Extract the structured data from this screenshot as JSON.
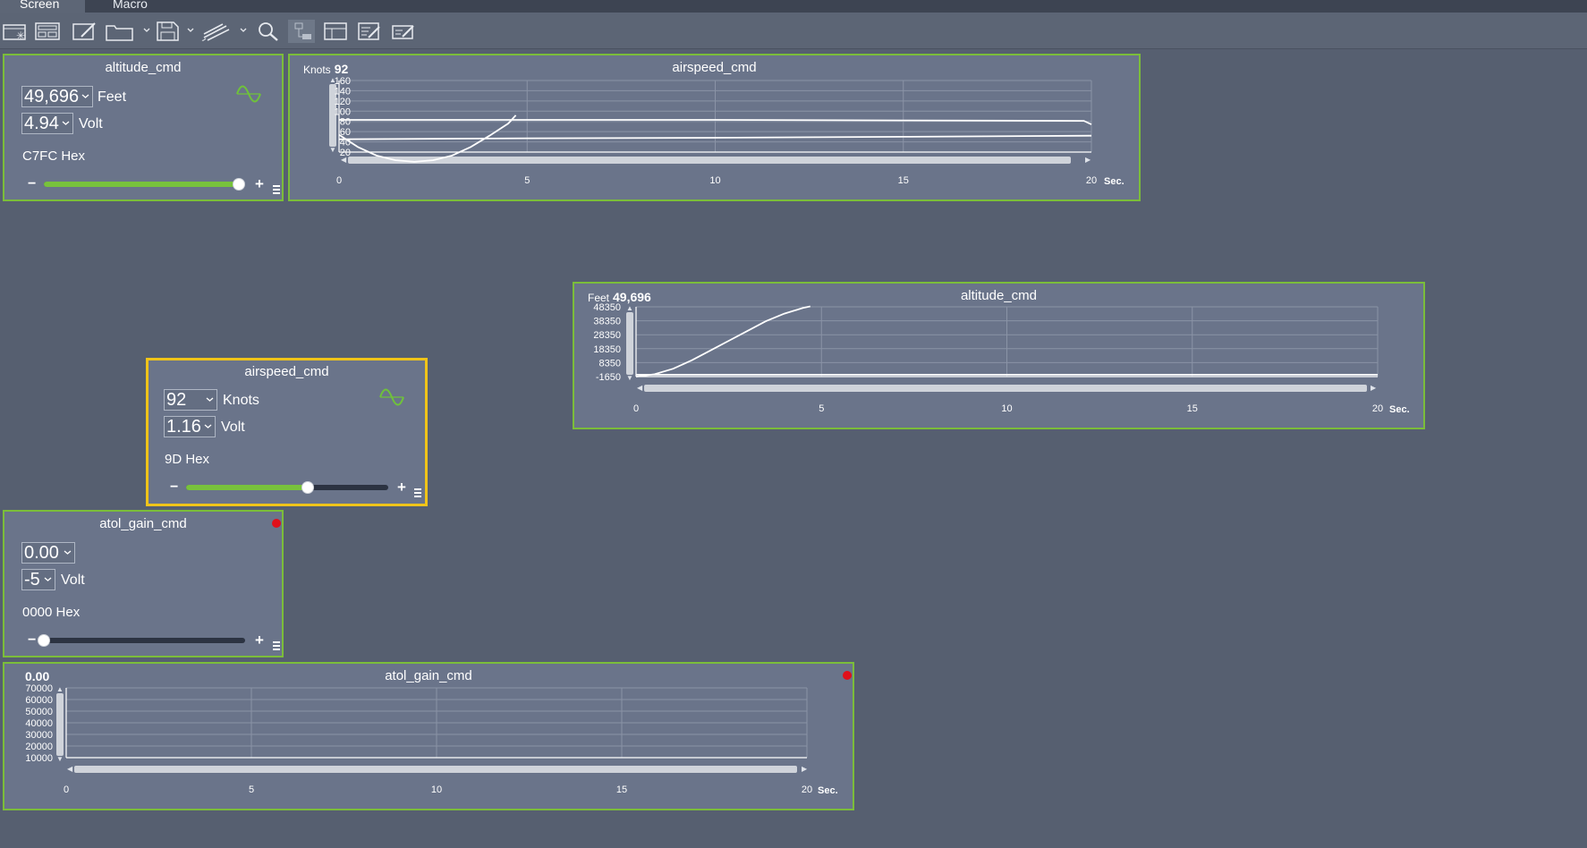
{
  "tabs": [
    {
      "label": "Screen",
      "active": true
    },
    {
      "label": "Macro",
      "active": false
    }
  ],
  "toolbar": {
    "buttons": [
      "new-screen-icon",
      "layout-icon",
      "edit-icon",
      "open-folder-icon",
      "save-icon",
      "plugin-icon",
      "search-icon",
      "route-icon",
      "table-icon",
      "edit-list-icon",
      "edit-form-icon"
    ]
  },
  "colors": {
    "background": "#565f70",
    "panel": "#6a748a",
    "panel_border": "#7bbd3a",
    "selected_border": "#f0c419",
    "slider_fill": "#78c23c",
    "alert": "#e0101a"
  },
  "control_altitude": {
    "title": "altitude_cmd",
    "value": "49,696",
    "unit": "Feet",
    "volt": "4.94",
    "volt_unit": "Volt",
    "hex": "C7FC Hex",
    "slider_fraction": 0.97
  },
  "control_airspeed": {
    "title": "airspeed_cmd",
    "value": "92",
    "unit": "Knots",
    "volt": "1.16",
    "volt_unit": "Volt",
    "hex": "9D Hex",
    "slider_fraction": 0.6
  },
  "control_atol": {
    "title": "atol_gain_cmd",
    "value": "0.00",
    "volt": "-5",
    "volt_unit": "Volt",
    "hex": "0000 Hex",
    "slider_fraction": 0.0
  },
  "chart_data": [
    {
      "id": "airspeed",
      "type": "line",
      "title": "airspeed_cmd",
      "readout_label": "Knots",
      "readout_value": "92",
      "xlabel": "Sec.",
      "xlim": [
        0,
        20
      ],
      "ylim": [
        20,
        160
      ],
      "x_ticks": [
        "0",
        "5",
        "10",
        "15",
        "20"
      ],
      "y_ticks": [
        "160",
        "140",
        "120",
        "100",
        "80",
        "60",
        "40",
        "20"
      ],
      "grid": true,
      "series": [
        {
          "x": [
            0,
            0.5,
            1,
            1.5,
            2,
            2.5,
            3,
            3.5,
            4,
            4.5,
            4.7
          ],
          "y": [
            54,
            30,
            13,
            4,
            1,
            4,
            13,
            30,
            52,
            76,
            92
          ]
        },
        {
          "x": [
            0,
            5,
            10,
            15,
            19.8,
            20
          ],
          "y": [
            83,
            83,
            83,
            82,
            81,
            74
          ]
        },
        {
          "x": [
            0,
            5,
            10,
            15,
            20
          ],
          "y": [
            45,
            47,
            48,
            50,
            52
          ]
        }
      ]
    },
    {
      "id": "altitude",
      "type": "line",
      "title": "altitude_cmd",
      "readout_label": "Feet",
      "readout_value": "49,696",
      "xlabel": "Sec.",
      "xlim": [
        0,
        20
      ],
      "ylim": [
        -1650,
        48350
      ],
      "x_ticks": [
        "0",
        "5",
        "10",
        "15",
        "20"
      ],
      "y_ticks": [
        "48350",
        "38350",
        "28350",
        "18350",
        "8350",
        "-1650"
      ],
      "grid": true,
      "series": [
        {
          "x": [
            0,
            0.5,
            1,
            1.5,
            2,
            2.5,
            3,
            3.5,
            4,
            4.5,
            4.7
          ],
          "y": [
            -1650,
            0,
            4000,
            10000,
            17000,
            24000,
            31000,
            38000,
            43500,
            47500,
            48700
          ]
        },
        {
          "x": [
            0,
            20
          ],
          "y": [
            -300,
            -300
          ]
        }
      ]
    },
    {
      "id": "atol",
      "type": "line",
      "title": "atol_gain_cmd",
      "readout_value": "0.00",
      "xlabel": "Sec.",
      "xlim": [
        0,
        20
      ],
      "ylim": [
        0,
        70000
      ],
      "x_ticks": [
        "0",
        "5",
        "10",
        "15",
        "20"
      ],
      "y_ticks": [
        "70000",
        "60000",
        "50000",
        "40000",
        "30000",
        "20000",
        "10000"
      ],
      "grid": true,
      "series": []
    }
  ]
}
